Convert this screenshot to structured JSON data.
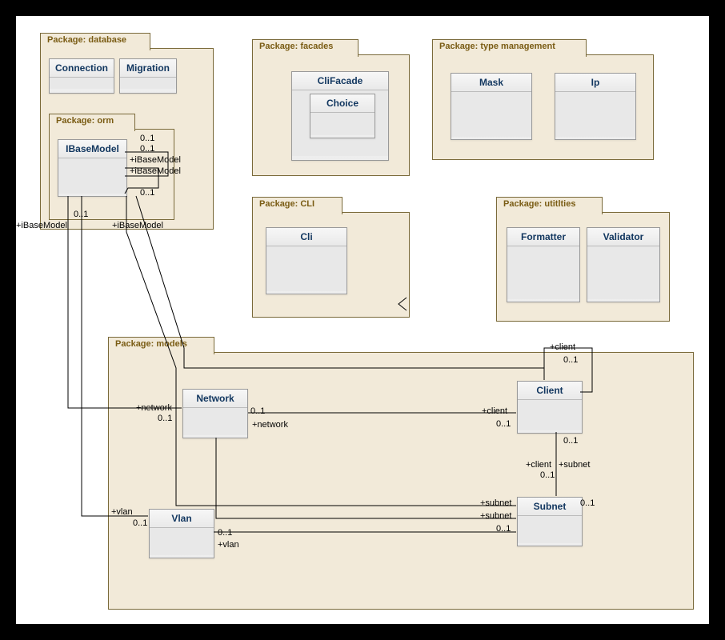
{
  "packages": {
    "database": {
      "title": "Package: database"
    },
    "orm": {
      "title": "Package: orm"
    },
    "facades": {
      "title": "Package: facades"
    },
    "type_management": {
      "title": "Package: type management"
    },
    "cli_pkg": {
      "title": "Package: CLI"
    },
    "utilities": {
      "title": "Package: utitlties"
    },
    "models": {
      "title": "Package: models"
    }
  },
  "classes": {
    "connection": "Connection",
    "migration": "Migration",
    "ibasemodel": "IBaseModel",
    "clifacade": "CliFacade",
    "choice": "Choice",
    "mask": "Mask",
    "ip": "Ip",
    "cli": "Cli",
    "formatter": "Formatter",
    "validator": "Validator",
    "network": "Network",
    "client": "Client",
    "vlan": "Vlan",
    "subnet": "Subnet"
  },
  "assoc_labels": {
    "m01_a": "0..1",
    "m01_b": "0..1",
    "ibase_a": "+iBaseModel",
    "ibase_b": "+iBaseModel",
    "m01_c": "0..1",
    "m01_d": "0..1",
    "ibase_c": "+iBaseModel",
    "ibase_d": "+iBaseModel",
    "network_role": "+network",
    "network_role2": "+network",
    "network_m1": "0..1",
    "network_m2": "0..1",
    "client_role": "+client",
    "client_role2": "+client",
    "client_role3": "+client",
    "client_m1": "0..1",
    "client_m2": "0..1",
    "client_m3": "0..1",
    "client_m4": "0..1",
    "subnet_role": "+subnet",
    "subnet_role2": "+subnet",
    "subnet_role3": "+subnet",
    "subnet_m1": "0..1",
    "subnet_m2": "0..1",
    "vlan_role": "+vlan",
    "vlan_role2": "+vlan",
    "vlan_m1": "0..1",
    "vlan_m2": "0..1"
  }
}
